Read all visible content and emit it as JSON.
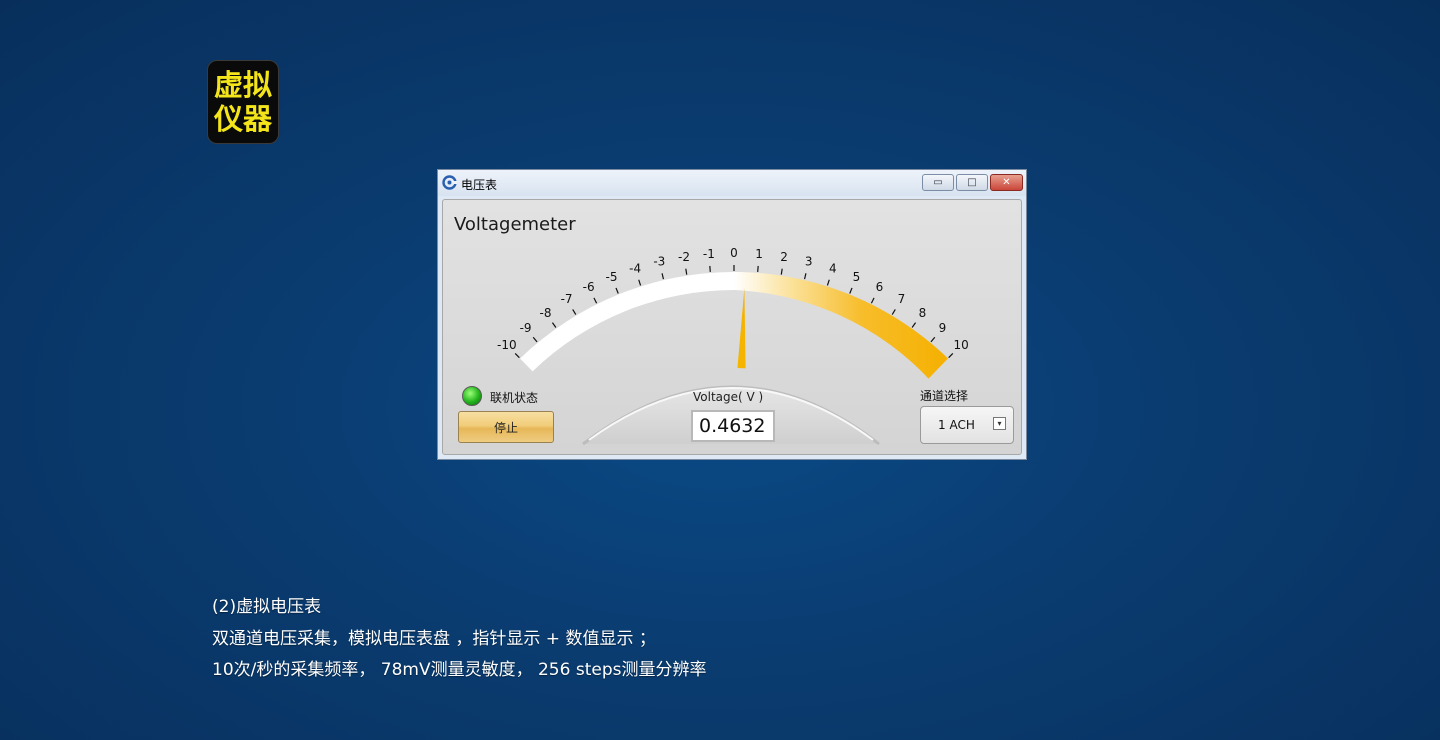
{
  "logo": {
    "line1": "虚拟",
    "line2": "仪器"
  },
  "window": {
    "title": "电压表",
    "buttons": {
      "minimize": "▭",
      "maximize": "□",
      "close": "✕"
    },
    "panel_title": "Voltagemeter",
    "gauge": {
      "min": -10,
      "max": 10,
      "tick_labels": [
        "-10",
        "-9",
        "-8",
        "-7",
        "-6",
        "-5",
        "-4",
        "-3",
        "-2",
        "-1",
        "0",
        "1",
        "2",
        "3",
        "4",
        "5",
        "6",
        "7",
        "8",
        "9",
        "10"
      ],
      "needle_value": 0.4632,
      "colors": {
        "negative_band": "#ffffff",
        "positive_band": "#f5b400",
        "needle": "#f5b400"
      }
    },
    "status": {
      "label": "联机状态",
      "led_color": "#21b31b"
    },
    "stop_button": "停止",
    "voltage": {
      "label": "Voltage( V )",
      "value": "0.4632"
    },
    "channel": {
      "label": "通道选择",
      "value": "1 ACH",
      "arrow": "▾"
    }
  },
  "captions": [
    "(2)虚拟电压表",
    "双通道电压采集，模拟电压表盘 ，指针显示 + 数值显示 ；",
    "10次/秒的采集频率， 78mV测量灵敏度， 256 steps测量分辨率"
  ]
}
